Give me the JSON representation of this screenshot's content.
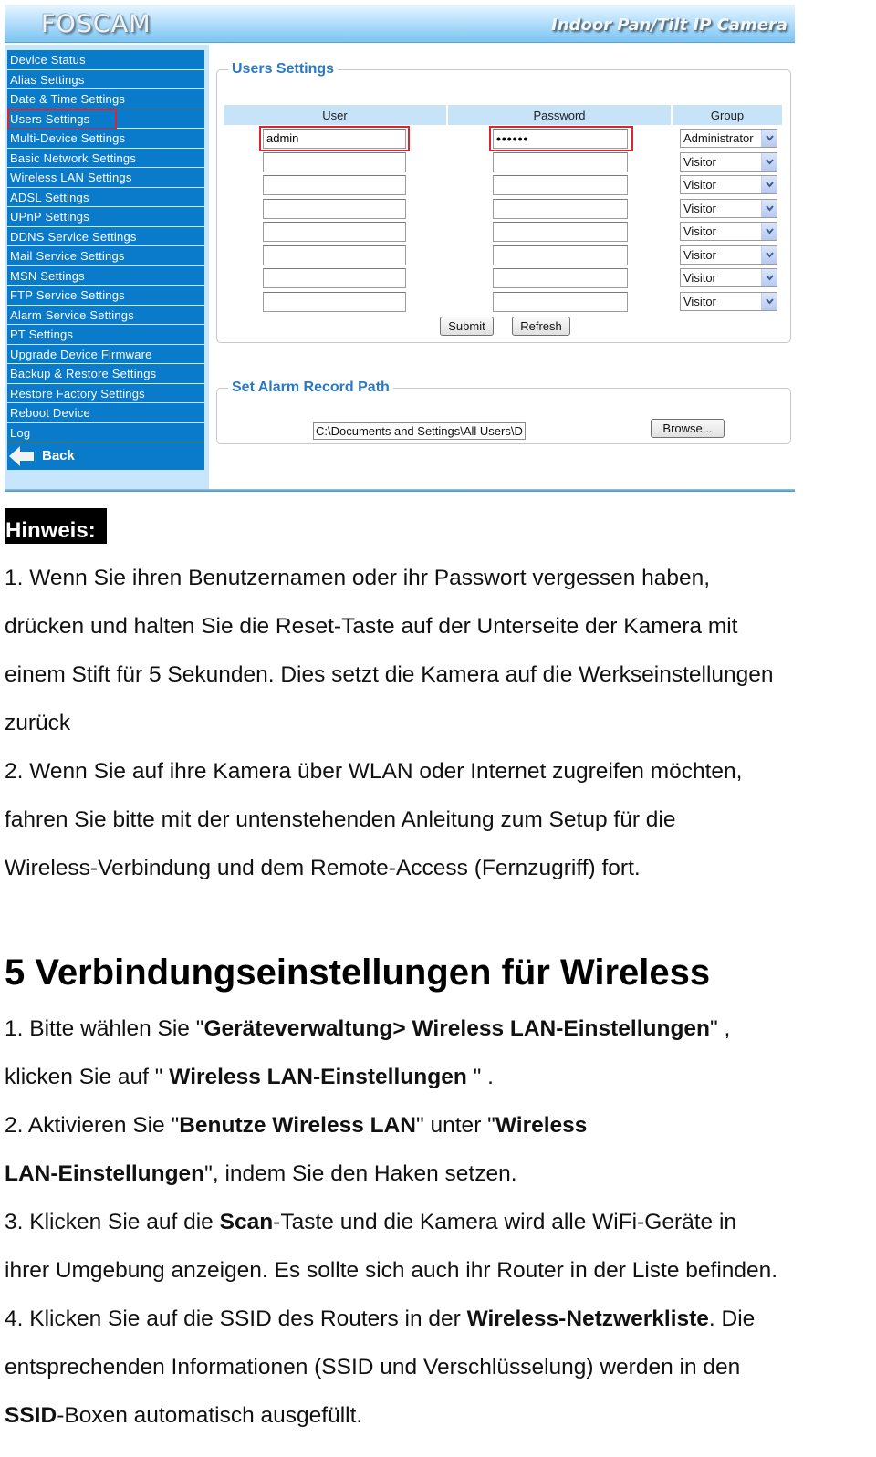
{
  "camera_ui": {
    "logo": "FOSCAM",
    "tagline": "Indoor Pan/Tilt IP Camera",
    "sidebar": {
      "items": [
        {
          "label": "Device Status"
        },
        {
          "label": "Alias Settings"
        },
        {
          "label": "Date & Time Settings"
        },
        {
          "label": "Users Settings",
          "highlighted": true
        },
        {
          "label": "Multi-Device Settings"
        },
        {
          "label": "Basic Network Settings"
        },
        {
          "label": "Wireless LAN Settings"
        },
        {
          "label": "ADSL Settings"
        },
        {
          "label": "UPnP Settings"
        },
        {
          "label": "DDNS Service Settings"
        },
        {
          "label": "Mail Service Settings"
        },
        {
          "label": "MSN Settings"
        },
        {
          "label": "FTP Service Settings"
        },
        {
          "label": "Alarm Service Settings"
        },
        {
          "label": "PT Settings"
        },
        {
          "label": "Upgrade Device Firmware"
        },
        {
          "label": "Backup & Restore Settings"
        },
        {
          "label": "Restore Factory Settings"
        },
        {
          "label": "Reboot Device"
        },
        {
          "label": "Log"
        }
      ],
      "back_label": "Back",
      "back_icon": "arrow-left-icon"
    },
    "users_settings": {
      "title": "Users Settings",
      "columns": [
        "User",
        "Password",
        "Group"
      ],
      "rows": [
        {
          "user": "admin",
          "password": "••••••",
          "group": "Administrator"
        },
        {
          "user": "",
          "password": "",
          "group": "Visitor"
        },
        {
          "user": "",
          "password": "",
          "group": "Visitor"
        },
        {
          "user": "",
          "password": "",
          "group": "Visitor"
        },
        {
          "user": "",
          "password": "",
          "group": "Visitor"
        },
        {
          "user": "",
          "password": "",
          "group": "Visitor"
        },
        {
          "user": "",
          "password": "",
          "group": "Visitor"
        },
        {
          "user": "",
          "password": "",
          "group": "Visitor"
        }
      ],
      "submit_label": "Submit",
      "refresh_label": "Refresh",
      "dropdown_icon": "chevron-down-icon"
    },
    "alarm_path": {
      "title": "Set Alarm Record Path",
      "path_value": "C:\\Documents and Settings\\All Users\\D",
      "browse_label": "Browse..."
    },
    "colors": {
      "menu_blue": "#0a7acb",
      "legend_blue": "#2b79c2",
      "highlight_red": "#d9262e",
      "header_light": "#c6e3f7"
    }
  },
  "document": {
    "note_label": "Hinweis:",
    "note_lines": [
      "1. Wenn Sie ihren Benutzernamen oder ihr Passwort vergessen haben,",
      "drücken und halten Sie die Reset-Taste auf der Unterseite der Kamera mit",
      "einem Stift für 5 Sekunden. Dies setzt die Kamera auf die Werkseinstellungen",
      "zurück",
      "2. Wenn Sie auf ihre Kamera über WLAN oder Internet zugreifen möchten,",
      "fahren Sie bitte mit der untenstehenden Anleitung zum Setup für die",
      "Wireless-Verbindung und dem Remote-Access (Fernzugriff) fort."
    ],
    "section_heading": "5 Verbindungseinstellungen für Wireless",
    "steps": {
      "s1a_pre": "1. Bitte wählen Sie \"",
      "s1a_bold": "Geräteverwaltung> Wireless LAN-Einstellungen",
      "s1a_post": "\" ,",
      "s1b_pre": "klicken Sie auf \" ",
      "s1b_bold": "Wireless LAN-Einstellungen",
      "s1b_post": " \" .",
      "s2a_pre": "2. Aktivieren Sie \"",
      "s2a_bold1": "Benutze Wireless LAN",
      "s2a_mid": "\" unter \"",
      "s2a_bold2": "Wireless",
      "s2b_bold": "LAN-Einstellungen",
      "s2b_post": "\", indem Sie den Haken setzen.",
      "s3a_pre": "3. Klicken Sie auf die ",
      "s3a_bold": "Scan",
      "s3a_post": "-Taste und die Kamera wird alle WiFi-Geräte in",
      "s3b": "ihrer Umgebung anzeigen. Es sollte sich auch ihr Router in der Liste befinden.",
      "s4a_pre": "4. Klicken Sie auf die SSID des Routers in der ",
      "s4a_bold": "Wireless-Netzwerkliste",
      "s4a_post": ". Die",
      "s4b": "entsprechenden Informationen (SSID und Verschlüsselung) werden in den",
      "s4c_bold": "SSID",
      "s4c_post": "-Boxen automatisch ausgefüllt."
    }
  }
}
